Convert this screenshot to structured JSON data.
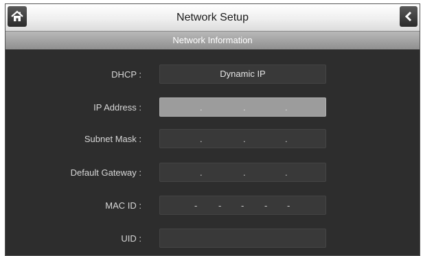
{
  "header": {
    "title": "Network Setup"
  },
  "subheader": {
    "title": "Network Information"
  },
  "fields": {
    "dhcp": {
      "label": "DHCP :",
      "value": "Dynamic IP"
    },
    "ip_address": {
      "label": "IP Address :",
      "sep": "."
    },
    "subnet_mask": {
      "label": "Subnet Mask :",
      "sep": "."
    },
    "default_gateway": {
      "label": "Default Gateway :",
      "sep": "."
    },
    "mac_id": {
      "label": "MAC ID :",
      "sep": "-"
    },
    "uid": {
      "label": "UID :",
      "value": ""
    }
  },
  "icons": {
    "home": "home-icon",
    "back": "chevron-left-icon"
  }
}
